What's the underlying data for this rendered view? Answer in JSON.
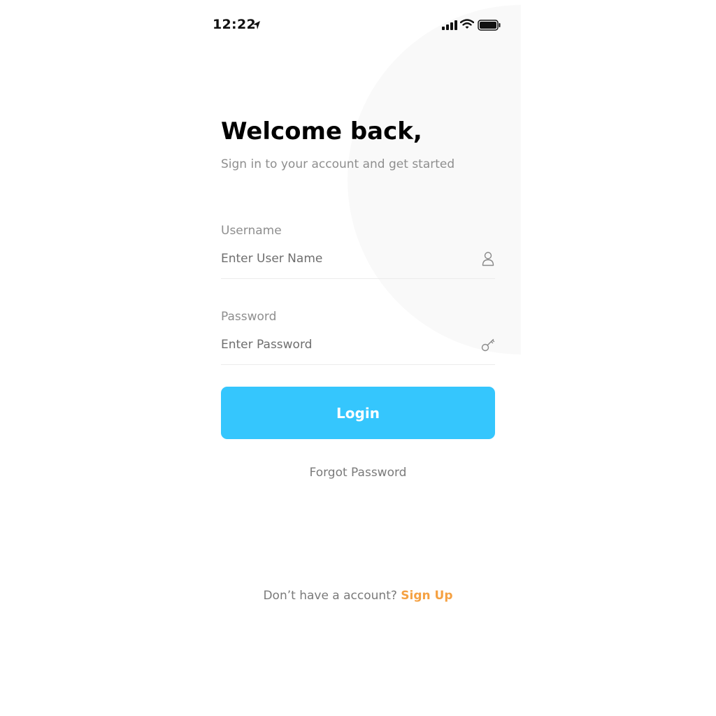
{
  "status_bar": {
    "time": "12:22",
    "icons": [
      "location-arrow-icon",
      "cellular-signal-icon",
      "wifi-icon",
      "battery-icon"
    ]
  },
  "header": {
    "title": "Welcome back,",
    "subtitle": "Sign in to your account and get started"
  },
  "form": {
    "username": {
      "label": "Username",
      "placeholder": "Enter User Name",
      "value": "",
      "icon": "user-icon"
    },
    "password": {
      "label": "Password",
      "placeholder": "Enter Password",
      "value": "",
      "icon": "key-icon"
    },
    "login_label": "Login"
  },
  "links": {
    "forgot_password": "Forgot Password",
    "signup_prompt": "Don’t have a account?",
    "signup_label": "Sign Up"
  },
  "colors": {
    "primary": "#35c6fd",
    "accent": "#f5a142",
    "title_text": "#000000",
    "muted_text": "#8e8e8e",
    "background_circle": "#f9f9f9"
  }
}
